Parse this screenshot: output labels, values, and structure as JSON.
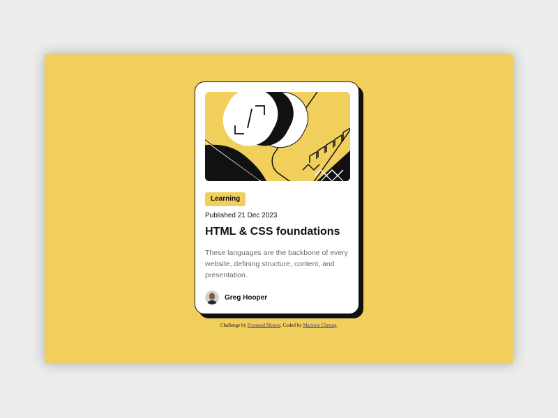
{
  "colors": {
    "page_background": "#eceeee",
    "accent_yellow": "#f1cf5c",
    "card_background": "#ffffff",
    "text_dark": "#111111",
    "text_muted": "#6b6b6b"
  },
  "card": {
    "image_name": "illustration-article",
    "tag_label": "Learning",
    "published": "Published 21 Dec 2023",
    "title": "HTML & CSS foundations",
    "description": "These languages are the backbone of every website, defining structure, content, and presentation.",
    "author": {
      "name": "Greg Hooper",
      "avatar_icon": "avatar"
    }
  },
  "attribution": {
    "prefix": "Challenge by ",
    "link1_label": "Frontend Mentor",
    "middle": ". Coded by ",
    "link2_label": "Marjorie Cheung",
    "suffix": "."
  }
}
